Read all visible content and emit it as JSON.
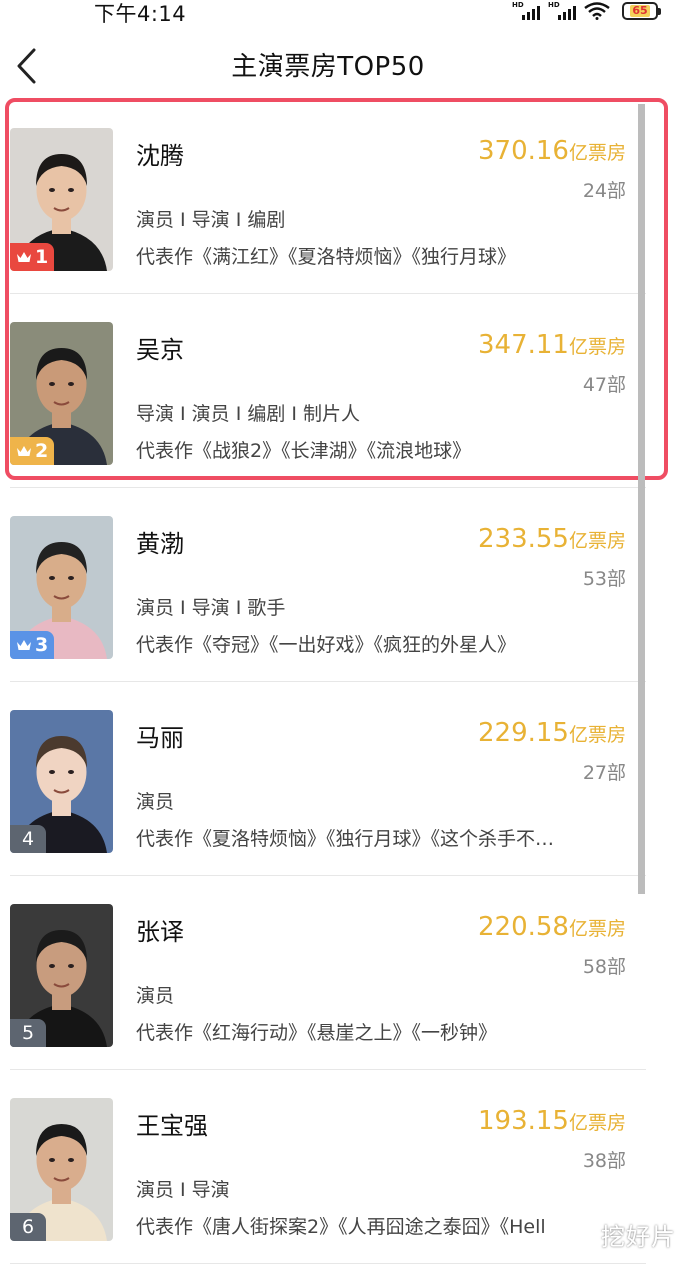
{
  "status_bar": {
    "time": "下午4:14",
    "signal_label_1": "HD",
    "signal_label_2": "HD",
    "battery": "65"
  },
  "nav": {
    "title": "主演票房TOP50",
    "back_icon": "chevron-left-icon"
  },
  "unit_label": "亿票房",
  "rank_icon": "crown-icon",
  "actors": [
    {
      "rank": "1",
      "name": "沈腾",
      "box_office": "370.16",
      "films": "24部",
      "roles": "演员 I 导演 I 编剧",
      "works": "代表作《满江红》《夏洛特烦恼》《独行月球》",
      "rank_color": "#e9483f"
    },
    {
      "rank": "2",
      "name": "吴京",
      "box_office": "347.11",
      "films": "47部",
      "roles": "导演 I 演员 I 编剧 I 制片人",
      "works": "代表作《战狼2》《长津湖》《流浪地球》",
      "rank_color": "#efb44a"
    },
    {
      "rank": "3",
      "name": "黄渤",
      "box_office": "233.55",
      "films": "53部",
      "roles": "演员 I 导演 I 歌手",
      "works": "代表作《夺冠》《一出好戏》《疯狂的外星人》",
      "rank_color": "#5a93e6"
    },
    {
      "rank": "4",
      "name": "马丽",
      "box_office": "229.15",
      "films": "27部",
      "roles": "演员",
      "works": "代表作《夏洛特烦恼》《独行月球》《这个杀手不…",
      "rank_color": "#5d6570"
    },
    {
      "rank": "5",
      "name": "张译",
      "box_office": "220.58",
      "films": "58部",
      "roles": "演员",
      "works": "代表作《红海行动》《悬崖之上》《一秒钟》",
      "rank_color": "#5d6570"
    },
    {
      "rank": "6",
      "name": "王宝强",
      "box_office": "193.15",
      "films": "38部",
      "roles": "演员 I 导演",
      "works": "代表作《唐人街探案2》《人再囧途之泰囧》《Hell",
      "rank_color": "#5d6570"
    }
  ],
  "colors": {
    "box_office": "#e8b235",
    "highlight_border": "#ef4d63"
  },
  "watermark": "挖好片"
}
